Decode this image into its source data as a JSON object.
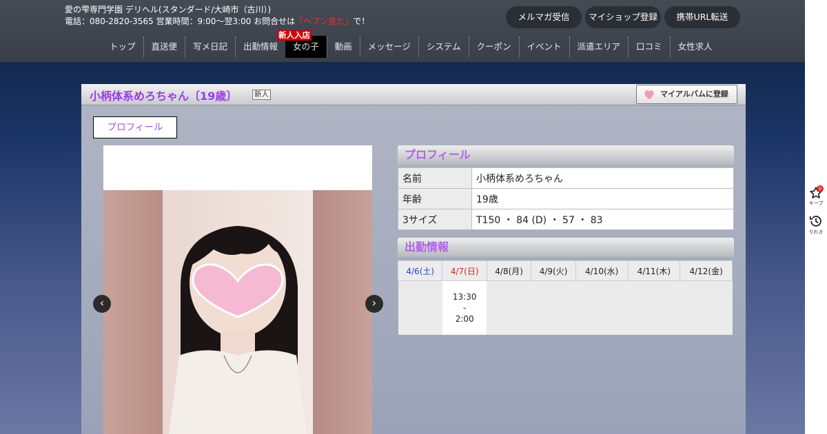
{
  "header": {
    "shop_line1": "愛の雫専門学園 デリヘル(スタンダード/大崎市（古川）)",
    "shop_line2_prefix": "電話：080-2820-3565 営業時間：9:00～翌3:00 お問合せは",
    "shop_line2_highlight": "「ヘブン見た」",
    "shop_line2_suffix": "で！",
    "buttons": [
      "メルマガ受信",
      "マイショップ登録",
      "携帯URL転送"
    ]
  },
  "nav": {
    "items": [
      "トップ",
      "直送便",
      "写メ日記",
      "出勤情報",
      "女の子",
      "動画",
      "メッセージ",
      "システム",
      "クーポン",
      "イベント",
      "派遣エリア",
      "口コミ",
      "女性求人"
    ],
    "active_index": 4,
    "badge": "新人入店"
  },
  "side": {
    "keep_label": "キープ",
    "keep_count": "0",
    "history_label": "りれき"
  },
  "profile_page": {
    "girl_title": "小柄体系めろちゃん〔19歳〕",
    "new_tag": "新人",
    "album_button": "マイアルバムに登録",
    "tab": "プロフィール",
    "profile_header": "プロフィール",
    "profile_rows": [
      {
        "label": "名前",
        "value": "小柄体系めろちゃん"
      },
      {
        "label": "年齢",
        "value": "19歳"
      },
      {
        "label": "3サイズ",
        "value": "T150 ・ 84 (D) ・ 57 ・ 83"
      }
    ],
    "schedule_header": "出勤情報",
    "schedule": {
      "days": [
        "4/6(土)",
        "4/7(日)",
        "4/8(月)",
        "4/9(火)",
        "4/10(水)",
        "4/11(木)",
        "4/12(金)"
      ],
      "shift_day_index": 1,
      "shift_start": "13:30",
      "shift_sep": "-",
      "shift_end": "2:00"
    }
  },
  "colors": {
    "accent_purple": "#9b3ce6",
    "badge_red": "#d40000",
    "saturday_blue": "#2244cc",
    "sunday_red": "#cc2222"
  }
}
